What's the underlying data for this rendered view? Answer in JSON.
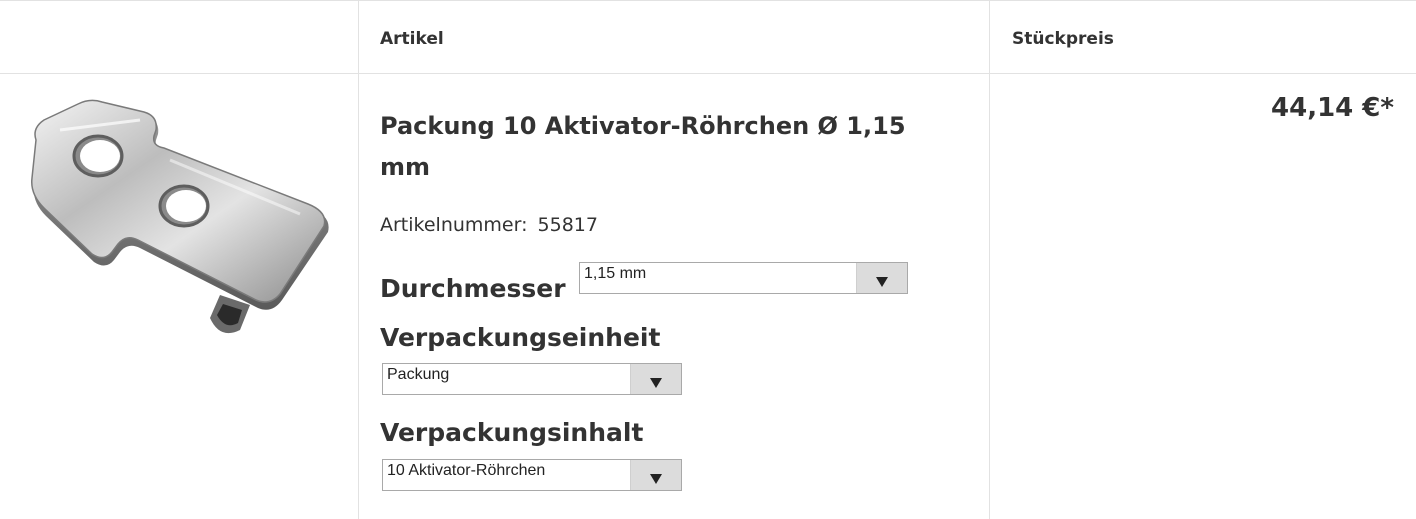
{
  "header": {
    "artikel": "Artikel",
    "stueckpreis": "Stückpreis"
  },
  "product": {
    "title": "Packung 10 Aktivator-Röhrchen Ø 1,15 mm",
    "artikelnummer_label": "Artikelnummer:",
    "artikelnummer_value": "55817",
    "price": "44,14 €*",
    "image_icon": "metal-bracket-product-image"
  },
  "options": {
    "durchmesser": {
      "label": "Durchmesser",
      "selected": "1,15 mm"
    },
    "verpackungseinheit": {
      "label": "Verpackungseinheit",
      "selected": "Packung"
    },
    "verpackungsinhalt": {
      "label": "Verpackungsinhalt",
      "selected": "10 Aktivator-Röhrchen"
    }
  },
  "colors": {
    "border": "#e2e2e2",
    "text": "#333333",
    "select_button": "#dcdcdc"
  }
}
